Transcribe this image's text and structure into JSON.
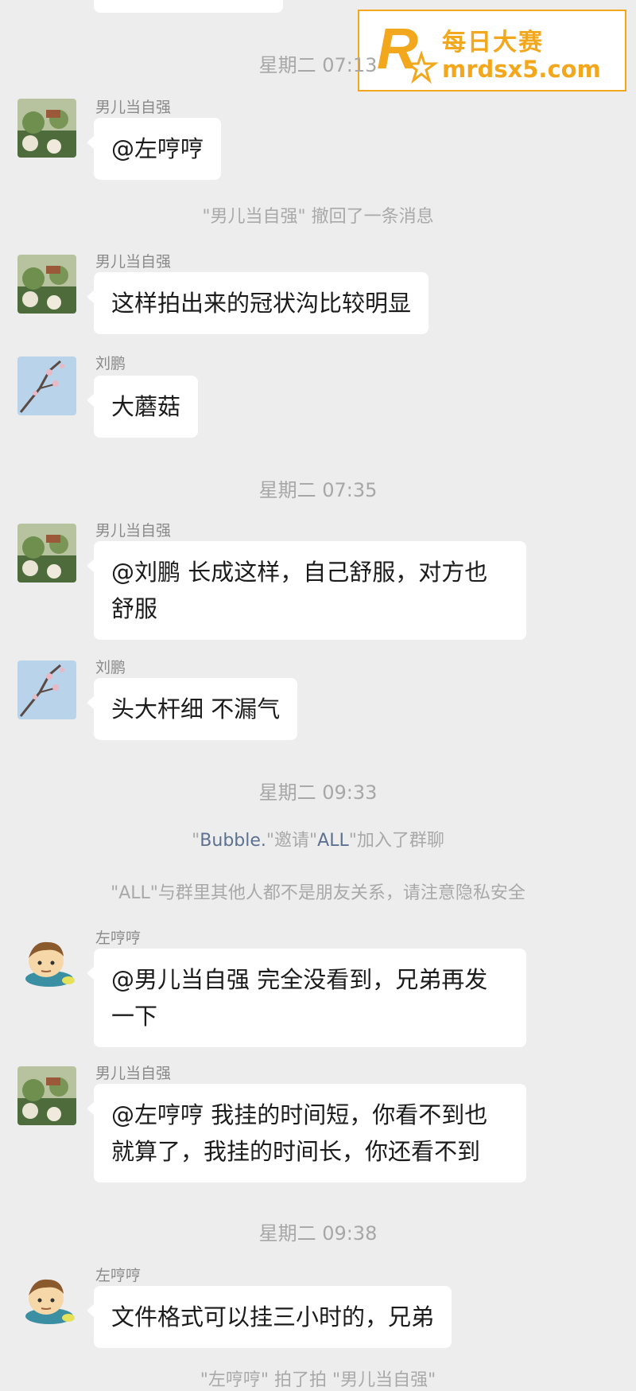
{
  "watermark": {
    "title": "每日大赛",
    "url": "mrdsx5.com",
    "colors": {
      "accent": "#f2a71d"
    }
  },
  "chat": {
    "timestamps": [
      "星期二 07:13",
      "星期二 07:35",
      "星期二 09:33",
      "星期二 09:38"
    ],
    "system": {
      "recall": "\"男儿当自强\" 撤回了一条消息",
      "invite_prefix": "\"",
      "invite_user": "Bubble.",
      "invite_mid": "\"邀请\"",
      "invite_target": "ALL",
      "invite_suffix": "\"加入了群聊",
      "privacy": "\"ALL\"与群里其他人都不是朋友关系，请注意隐私安全",
      "pat": "\"左哼哼\" 拍了拍 \"男儿当自强\""
    },
    "messages": [
      {
        "sender": "男儿当自强",
        "avatar": "landscape-avatar",
        "text": "@左哼哼"
      },
      {
        "sender": "男儿当自强",
        "avatar": "landscape-avatar",
        "text": "这样拍出来的冠状沟比较明显"
      },
      {
        "sender": "刘鹏",
        "avatar": "blossom-avatar",
        "text": "大蘑菇"
      },
      {
        "sender": "男儿当自强",
        "avatar": "landscape-avatar",
        "text": "@刘鹏 长成这样，自己舒服，对方也舒服"
      },
      {
        "sender": "刘鹏",
        "avatar": "blossom-avatar",
        "text": "头大杆细 不漏气"
      },
      {
        "sender": "左哼哼",
        "avatar": "cartoon-kid-avatar",
        "text": "@男儿当自强 完全没看到，兄弟再发一下"
      },
      {
        "sender": "男儿当自强",
        "avatar": "landscape-avatar",
        "text": "@左哼哼 我挂的时间短，你看不到也就算了，我挂的时间长，你还看不到"
      },
      {
        "sender": "左哼哼",
        "avatar": "cartoon-kid-avatar",
        "text": "文件格式可以挂三小时的，兄弟"
      }
    ]
  }
}
